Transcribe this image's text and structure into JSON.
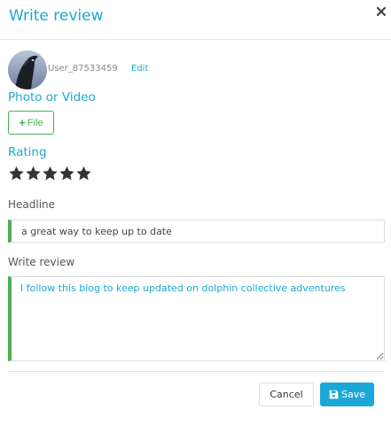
{
  "modal": {
    "title": "Write review",
    "close_icon": "close-icon",
    "close_symbol": "×"
  },
  "user": {
    "name": "User_87533459",
    "edit_label": "Edit"
  },
  "photo": {
    "label": "Photo or Video",
    "file_button_label": "File",
    "file_icon": "plus-icon"
  },
  "rating": {
    "label": "Rating",
    "value": 5,
    "max": 5,
    "star_color": "#333333"
  },
  "headline": {
    "label": "Headline",
    "value": "a great way to keep up to date"
  },
  "review": {
    "label": "Write review",
    "value": "I follow this blog to keep updated on dolphin collective adventures"
  },
  "actions": {
    "cancel_label": "Cancel",
    "save_label": "Save",
    "save_icon": "floppy-disk-icon"
  },
  "colors": {
    "accent": "#1ba8d6",
    "success": "#4caf50"
  }
}
